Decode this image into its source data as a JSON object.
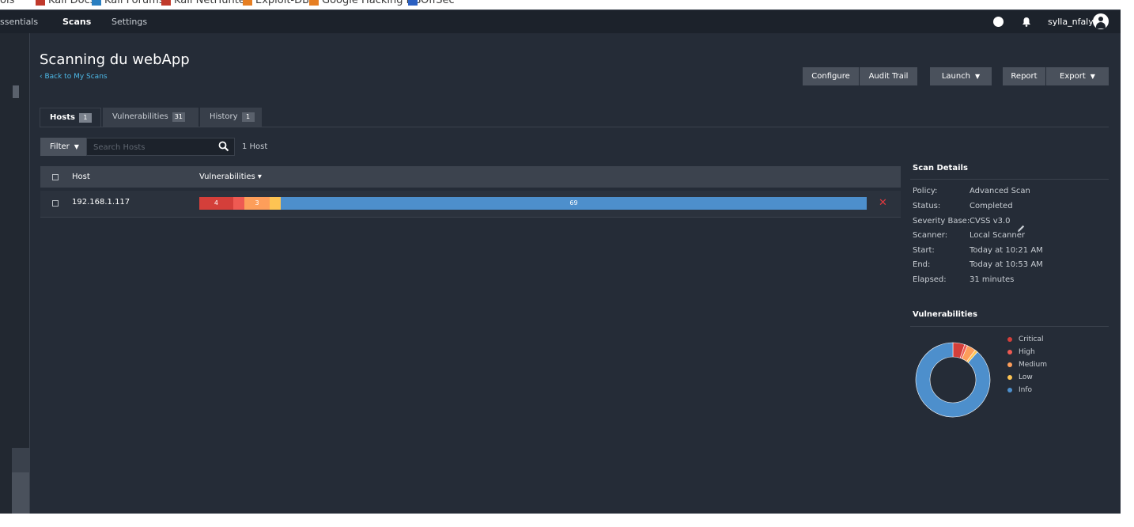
{
  "bookmarks": [
    {
      "label": "ols",
      "color": "#444444"
    },
    {
      "label": "Kali Docs",
      "color": "#c0392b"
    },
    {
      "label": "Kali Forums",
      "color": "#2a7fc1"
    },
    {
      "label": "Kali NetHunter",
      "color": "#c0392b"
    },
    {
      "label": "Exploit-DB",
      "color": "#e67e22"
    },
    {
      "label": "Google Hacking DB",
      "color": "#e67e22"
    },
    {
      "label": "OffSec",
      "color": "#2a5fc1"
    }
  ],
  "topnav": {
    "items": [
      "ssentials",
      "Scans",
      "Settings"
    ],
    "active": "Scans",
    "username": "sylla_nfaly",
    "icons": [
      "help-icon",
      "bell-icon",
      "user-avatar-icon"
    ]
  },
  "page": {
    "title": "Scanning du webApp",
    "back_link": "‹ Back to My Scans"
  },
  "toolbar": {
    "configure": "Configure",
    "audit_trail": "Audit Trail",
    "launch": "Launch",
    "report": "Report",
    "export": "Export"
  },
  "tabs": [
    {
      "label": "Hosts",
      "count": "1",
      "active": true
    },
    {
      "label": "Vulnerabilities",
      "count": "31",
      "active": false
    },
    {
      "label": "History",
      "count": "1",
      "active": false
    }
  ],
  "filter": {
    "label": "Filter",
    "placeholder": "Search Hosts",
    "result_count": "1 Host"
  },
  "table": {
    "columns": [
      "Host",
      "Vulnerabilities ▾"
    ],
    "rows": [
      {
        "host": "192.168.1.117",
        "breakdown": [
          {
            "severity": "Critical",
            "label": "4",
            "value": 4,
            "color": "#d43f3a"
          },
          {
            "severity": "High",
            "label": "",
            "value": 1.3,
            "color": "#ee5a52"
          },
          {
            "severity": "Medium",
            "label": "3",
            "value": 3,
            "color": "#fd9e5a"
          },
          {
            "severity": "Low",
            "label": "",
            "value": 1.3,
            "color": "#fdc453"
          },
          {
            "severity": "Info",
            "label": "69",
            "value": 69,
            "color": "#4d8fcc"
          }
        ]
      }
    ]
  },
  "scan_details": {
    "heading": "Scan Details",
    "fields": [
      {
        "key": "Policy:",
        "value": "Advanced Scan"
      },
      {
        "key": "Status:",
        "value": "Completed"
      },
      {
        "key": "Severity Base:",
        "value": "CVSS v3.0"
      },
      {
        "key": "Scanner:",
        "value": "Local Scanner"
      },
      {
        "key": "Start:",
        "value": "Today at 10:21 AM"
      },
      {
        "key": "End:",
        "value": "Today at 10:53 AM"
      },
      {
        "key": "Elapsed:",
        "value": "31 minutes"
      }
    ]
  },
  "vulnerabilities_chart": {
    "heading": "Vulnerabilities",
    "legend": [
      {
        "label": "Critical",
        "color": "#d43f3a"
      },
      {
        "label": "High",
        "color": "#ee5a52"
      },
      {
        "label": "Medium",
        "color": "#fd9e5a"
      },
      {
        "label": "Low",
        "color": "#fdc453"
      },
      {
        "label": "Info",
        "color": "#4d8fcc"
      }
    ],
    "values": [
      4,
      1,
      3,
      1,
      69
    ]
  }
}
